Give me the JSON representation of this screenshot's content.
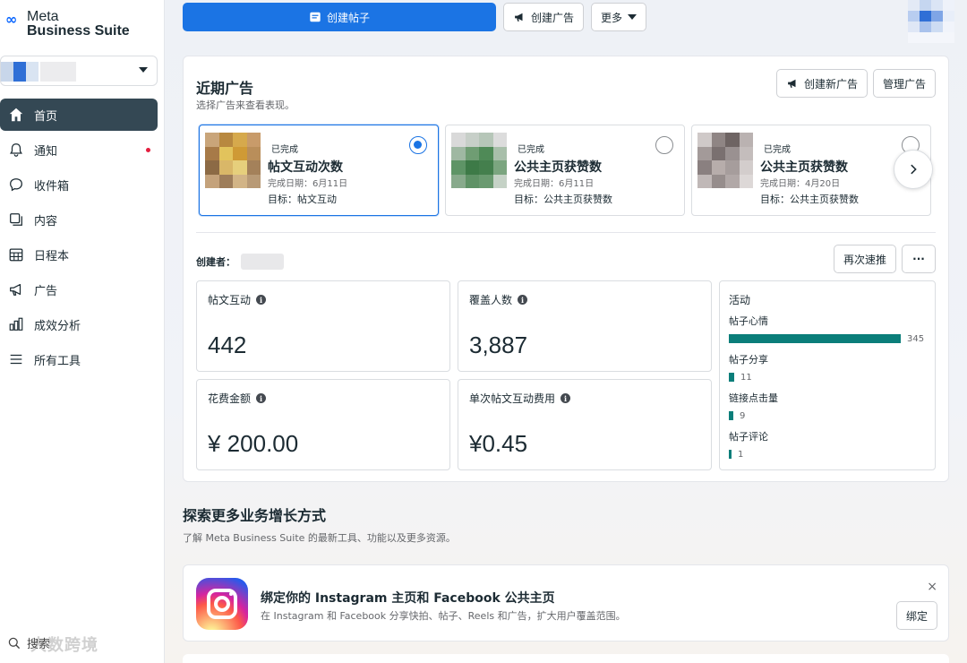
{
  "app": {
    "logo_line1": "Meta",
    "logo_line2": "Business Suite"
  },
  "sidebar": {
    "items": [
      {
        "label": "首页",
        "icon": "home-icon",
        "active": true
      },
      {
        "label": "通知",
        "icon": "bell-icon",
        "badge": true
      },
      {
        "label": "收件箱",
        "icon": "chat-bubble-icon"
      },
      {
        "label": "内容",
        "icon": "content-icon"
      },
      {
        "label": "日程本",
        "icon": "calendar-icon"
      },
      {
        "label": "广告",
        "icon": "megaphone-icon"
      },
      {
        "label": "成效分析",
        "icon": "bar-chart-icon"
      },
      {
        "label": "所有工具",
        "icon": "menu-icon"
      }
    ],
    "search_label": "搜索",
    "watermark": "大数跨境"
  },
  "topbar": {
    "create_post": "创建帖子",
    "create_ad": "创建广告",
    "more": "更多"
  },
  "recent_ads": {
    "title": "近期广告",
    "subtitle": "选择广告来查看表现。",
    "create_new_ad": "创建新广告",
    "manage_ads": "管理广告",
    "ads": [
      {
        "status": "已完成",
        "name": "帖文互动次数",
        "date": "完成日期：6月11日",
        "goal": "目标：帖文互动",
        "selected": true
      },
      {
        "status": "已完成",
        "name": "公共主页获赞数",
        "date": "完成日期：6月11日",
        "goal": "目标：公共主页获赞数",
        "selected": false
      },
      {
        "status": "已完成",
        "name": "公共主页获赞数",
        "date": "完成日期：4月20日",
        "goal": "目标：公共主页获赞数",
        "selected": false
      }
    ],
    "creator_label": "创建者：",
    "boost_again": "再次速推",
    "more_dots": "···"
  },
  "metrics": [
    {
      "label": "帖文互动",
      "value": "442"
    },
    {
      "label": "覆盖人数",
      "value": "3,887"
    },
    {
      "label": "花费金额",
      "value": "¥ 200.00"
    },
    {
      "label": "单次帖文互动费用",
      "value": "¥0.45"
    }
  ],
  "activity": {
    "title": "活动",
    "max": 345,
    "rows": [
      {
        "label": "帖子心情",
        "value": 345
      },
      {
        "label": "帖子分享",
        "value": 11
      },
      {
        "label": "链接点击量",
        "value": 9
      },
      {
        "label": "帖子评论",
        "value": 1
      }
    ],
    "bar_color": "#0b7e7a"
  },
  "explore": {
    "title": "探索更多业务增长方式",
    "subtitle": "了解 Meta Business Suite 的最新工具、功能以及更多资源。"
  },
  "instagram_card": {
    "title": "绑定你的 Instagram 主页和 Facebook 公共主页",
    "subtitle": "在 Instagram 和 Facebook 分享快拍、帖子、Reels 和广告，扩大用户覆盖范围。",
    "bind": "绑定",
    "close": "×"
  },
  "colors": {
    "primary": "#1b74e4",
    "active_nav": "#344854",
    "notification_dot": "#e41e3f"
  }
}
